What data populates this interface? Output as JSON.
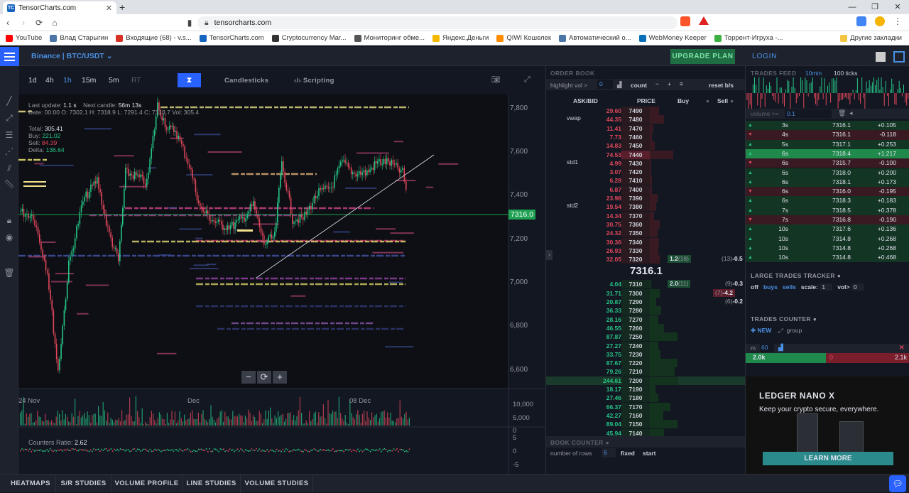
{
  "browser": {
    "tab_title": "TensorCharts.com",
    "tab_favicon": "TC",
    "new_tab": "+",
    "url": "tensorcharts.com",
    "bookmarks": [
      {
        "label": "YouTube",
        "color": "#ff0000"
      },
      {
        "label": "Влад Старыгин",
        "color": "#4a76a8"
      },
      {
        "label": "Входящие (68) - v.s...",
        "color": "#d93025"
      },
      {
        "label": "TensorCharts.com",
        "color": "#1565c0"
      },
      {
        "label": "Cryptocurrency Mar...",
        "color": "#333333"
      },
      {
        "label": "Мониторинг обме...",
        "color": "#555555"
      },
      {
        "label": "Яндекс.Деньги",
        "color": "#f5b800"
      },
      {
        "label": "QIWI Кошелек",
        "color": "#ff8c00"
      },
      {
        "label": "Автоматический о...",
        "color": "#4a76a8"
      },
      {
        "label": "WebMoney Keeper",
        "color": "#0a6fb8"
      },
      {
        "label": "Торрент-Игруха -...",
        "color": "#3cb043"
      }
    ],
    "other_bookmarks": "Другие закладки"
  },
  "header": {
    "symbol": "Binance | BTC/USDT",
    "upgrade": "UPGRADE PLAN",
    "login": "LOGIN"
  },
  "chart": {
    "timeframes": [
      "1d",
      "4h",
      "1h",
      "15m",
      "5m",
      "RT"
    ],
    "active_timeframe": "1h",
    "candlesticks": "Candlesticks",
    "scripting": "Scripting",
    "info": {
      "last_update_label": "Last update:",
      "last_update": "1.1 s",
      "next_candle_label": "Next candle:",
      "next_candle": "56m 13s",
      "ohlc_line_label": "Date: 00:00 O: 7302.1 H: 7318.9 L: 7291.4 C: 7313.7 Vol: 305.4",
      "total_label": "Total:",
      "total": "305.41",
      "buy_label": "Buy:",
      "buy": "221.02",
      "sell_label": "Sell:",
      "sell": "84.39",
      "delta_label": "Delta:",
      "delta": "136.64"
    },
    "price_axis": [
      "7,800",
      "7,600",
      "7,400",
      "7,200",
      "7,000",
      "6,800",
      "6,600"
    ],
    "current_price": "7316.0",
    "date_axis": [
      "24 Nov",
      "Dec",
      "08 Dec"
    ],
    "volume_axis": [
      "10,000",
      "5,000",
      "0"
    ],
    "ratio_axis": [
      "5",
      "0",
      "-5"
    ],
    "counters_ratio_label": "Counters Ratio:",
    "counters_ratio": "2.62",
    "zoom": [
      "−",
      "⟳",
      "+"
    ],
    "accent": "#26c485",
    "down_color": "#e0475a"
  },
  "orderbook": {
    "title": "ORDER BOOK",
    "highlight_label": "highlight vol >",
    "highlight_value": "0",
    "count_label": "count",
    "reset_label": "reset b/s",
    "columns": [
      "ASK/BID",
      "PRICE",
      "Buy",
      "Sell"
    ],
    "labels": [
      "vwap",
      "std1",
      "std2"
    ],
    "asks": [
      {
        "q": "29.60",
        "p": "7490"
      },
      {
        "q": "44.35",
        "p": "7480"
      },
      {
        "q": "11.41",
        "p": "7470"
      },
      {
        "q": "7.73",
        "p": "7460"
      },
      {
        "q": "14.83",
        "p": "7450"
      },
      {
        "q": "74.53",
        "p": "7440"
      },
      {
        "q": "4.99",
        "p": "7430"
      },
      {
        "q": "3.07",
        "p": "7420"
      },
      {
        "q": "6.28",
        "p": "7410"
      },
      {
        "q": "6.87",
        "p": "7400"
      },
      {
        "q": "23.98",
        "p": "7390"
      },
      {
        "q": "19.54",
        "p": "7380"
      },
      {
        "q": "14.34",
        "p": "7370"
      },
      {
        "q": "30.75",
        "p": "7360"
      },
      {
        "q": "24.32",
        "p": "7350"
      },
      {
        "q": "30.36",
        "p": "7340"
      },
      {
        "q": "26.93",
        "p": "7330"
      },
      {
        "q": "32.05",
        "p": "7320"
      }
    ],
    "mid_price": "7316.1",
    "bids": [
      {
        "q": "4.04",
        "p": "7310"
      },
      {
        "q": "31.71",
        "p": "7300"
      },
      {
        "q": "20.87",
        "p": "7290"
      },
      {
        "q": "36.33",
        "p": "7280"
      },
      {
        "q": "28.16",
        "p": "7270"
      },
      {
        "q": "46.55",
        "p": "7260"
      },
      {
        "q": "87.87",
        "p": "7250"
      },
      {
        "q": "27.27",
        "p": "7240"
      },
      {
        "q": "33.75",
        "p": "7230"
      },
      {
        "q": "87.67",
        "p": "7220"
      },
      {
        "q": "79.26",
        "p": "7210"
      },
      {
        "q": "244.61",
        "p": "7200"
      },
      {
        "q": "18.17",
        "p": "7190"
      },
      {
        "q": "27.46",
        "p": "7180"
      },
      {
        "q": "66.37",
        "p": "7170"
      },
      {
        "q": "42.27",
        "p": "7160"
      },
      {
        "q": "89.04",
        "p": "7150"
      },
      {
        "q": "45.94",
        "p": "7140"
      }
    ],
    "buy_7320": "1.2",
    "buy_7320_count": "(18)",
    "sell_7320": "-0.5",
    "sell_7320_count": "(13)",
    "buy_7310": "2.0",
    "buy_7310_count": "(11)",
    "sell_7310": "-0.3",
    "sell_7310_count": "(9)",
    "sell_7300": "-4.2",
    "sell_7300_count": "(7)",
    "sell_7290": "-0.2",
    "sell_7290_count": "(6)",
    "book_counter": "BOOK COUNTER",
    "rows_label": "number of rows",
    "rows_value": "6",
    "fixed": "fixed",
    "start": "start"
  },
  "tradesfeed": {
    "title": "TRADES FEED",
    "opt1": "10min",
    "opt2": "100 ticks",
    "volume_label": "volume >=",
    "volume_value": "0.1",
    "rows": [
      {
        "t": "3s",
        "p": "7316.1",
        "v": "+0.105",
        "side": "buy",
        "big": false
      },
      {
        "t": "4s",
        "p": "7316.1",
        "v": "-0.118",
        "side": "sell",
        "big": false
      },
      {
        "t": "5s",
        "p": "7317.1",
        "v": "+0.253",
        "side": "buy",
        "big": false
      },
      {
        "t": "6s",
        "p": "7318.4",
        "v": "+1.217",
        "side": "buy",
        "big": true
      },
      {
        "t": "6s",
        "p": "7315.7",
        "v": "-0.100",
        "side": "sell",
        "big": false
      },
      {
        "t": "6s",
        "p": "7318.0",
        "v": "+0.200",
        "side": "buy",
        "big": false
      },
      {
        "t": "6s",
        "p": "7318.1",
        "v": "+0.173",
        "side": "buy",
        "big": false
      },
      {
        "t": "6s",
        "p": "7316.0",
        "v": "-0.195",
        "side": "sell",
        "big": false
      },
      {
        "t": "6s",
        "p": "7318.3",
        "v": "+0.183",
        "side": "buy",
        "big": false
      },
      {
        "t": "7s",
        "p": "7318.5",
        "v": "+0.378",
        "side": "buy",
        "big": false
      },
      {
        "t": "7s",
        "p": "7316.8",
        "v": "-0.190",
        "side": "sell",
        "big": false
      },
      {
        "t": "10s",
        "p": "7317.6",
        "v": "+0.136",
        "side": "buy",
        "big": false
      },
      {
        "t": "10s",
        "p": "7314.8",
        "v": "+0.268",
        "side": "buy",
        "big": false
      },
      {
        "t": "10s",
        "p": "7314.8",
        "v": "+0.268",
        "side": "buy",
        "big": false
      },
      {
        "t": "10s",
        "p": "7314.8",
        "v": "+0.468",
        "side": "buy",
        "big": false
      }
    ],
    "ltt_title": "LARGE TRADES TRACKER",
    "ltt_off": "off",
    "ltt_buys": "buys",
    "ltt_sells": "sells",
    "ltt_scale_label": "scale:",
    "ltt_scale": "1",
    "ltt_vol_label": "vol>",
    "ltt_vol": "0",
    "tc_title": "TRADES COUNTER",
    "tc_new": "NEW",
    "tc_group": "group",
    "tc_m_label": "m",
    "tc_m": "60",
    "tc_buy": "2.0k",
    "tc_sell_zero": "0",
    "tc_sell": "2.1k",
    "tc_buy_fraction": 0.49
  },
  "ad": {
    "title": "LEDGER NANO X",
    "sub": "Keep your crypto secure, everywhere.",
    "button": "LEARN MORE"
  },
  "bottom_tabs": [
    "HEATMAPS",
    "S/R STUDIES",
    "VOLUME PROFILE",
    "LINE STUDIES",
    "VOLUME STUDIES"
  ]
}
